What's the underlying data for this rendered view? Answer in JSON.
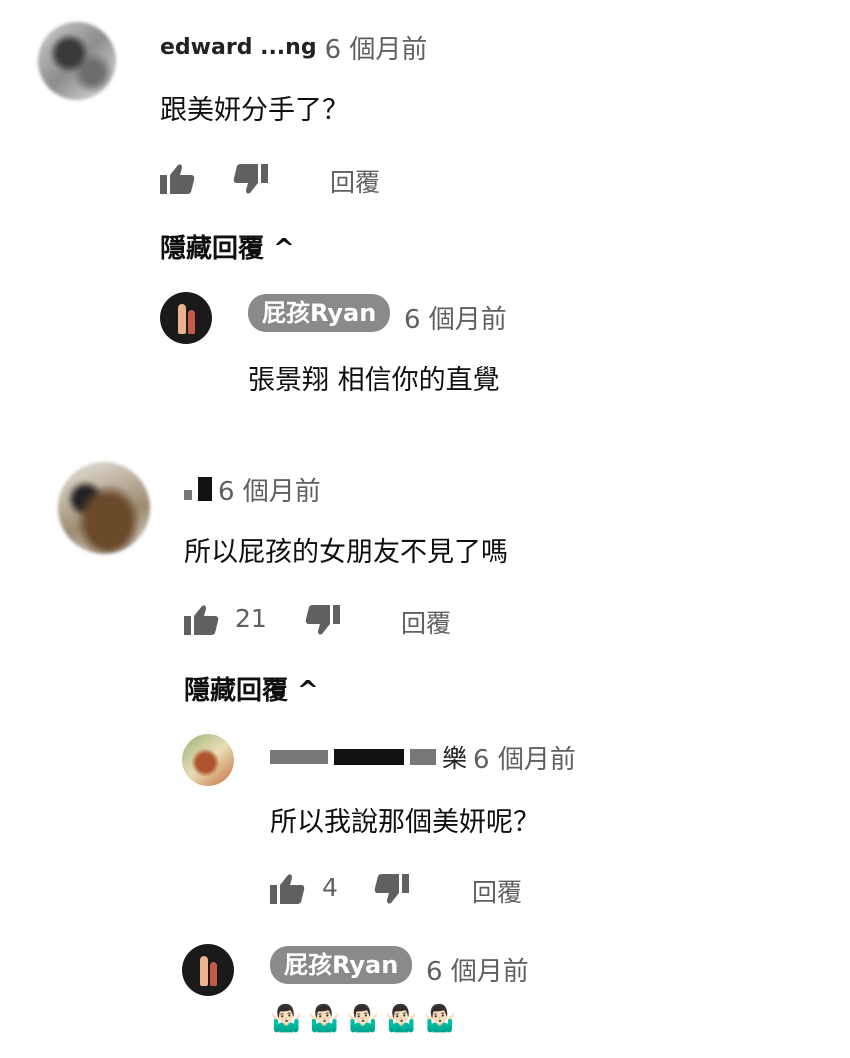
{
  "thread1": {
    "author": "edward ...ng",
    "time": "6 個月前",
    "text": "跟美妍分手了？",
    "reply_label": "回覆",
    "hide_replies": "隱藏回覆 ^",
    "reply": {
      "author": "屁孩Ryan",
      "time": "6 個月前",
      "text": "張景翔 相信你的直覺"
    }
  },
  "thread2": {
    "author": "",
    "time": "6 個月前",
    "text": "所以屁孩的女朋友不見了嗎",
    "likes": "21",
    "reply_label": "回覆",
    "hide_replies": "隱藏回覆 ^",
    "replies": [
      {
        "author_suffix": "樂",
        "time": "6 個月前",
        "text": "所以我說那個美妍呢？",
        "likes": "4",
        "reply_label": "回覆"
      },
      {
        "author": "屁孩Ryan",
        "time": "6 個月前",
        "text": "🤷🏻‍♂️🤷🏻‍♂️🤷🏻‍♂️🤷🏻‍♂️🤷🏻‍♂️"
      }
    ]
  }
}
